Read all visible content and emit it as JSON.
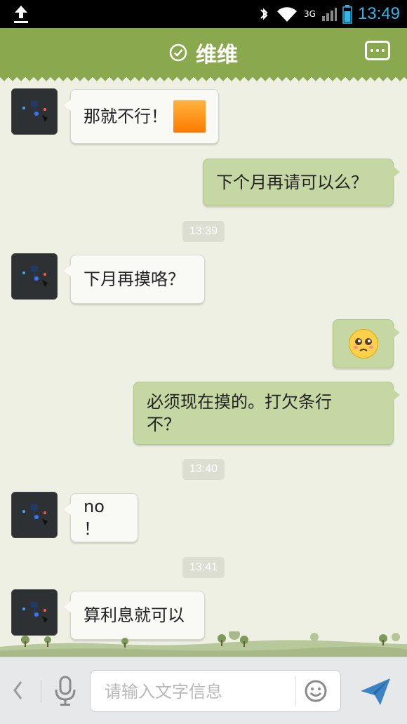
{
  "status_bar": {
    "time": "13:49",
    "network_label": "3G",
    "icons": [
      "upload-icon",
      "bluetooth-icon",
      "wifi-icon",
      "signal-icon",
      "battery-icon"
    ]
  },
  "header": {
    "title": "维维",
    "status_icon": "check-circle-icon",
    "menu_icon": "more-icon"
  },
  "messages": [
    {
      "side": "in",
      "text": "那就不行！",
      "sticker": "orange-sticker"
    },
    {
      "side": "out",
      "text": "下个月再请可以么？"
    },
    {
      "type": "timestamp",
      "text": "13:39"
    },
    {
      "side": "in",
      "text": "下月再摸咯？"
    },
    {
      "side": "out",
      "emoji": "crying-face-emoji"
    },
    {
      "side": "out",
      "text": "必须现在摸的。打欠条行不？"
    },
    {
      "type": "timestamp",
      "text": "13:40"
    },
    {
      "side": "in",
      "text": "no ！"
    },
    {
      "type": "timestamp",
      "text": "13:41"
    },
    {
      "side": "in",
      "text": "算利息就可以"
    }
  ],
  "input_bar": {
    "placeholder": "请输入文字信息",
    "value": "",
    "icons": [
      "back-chevron-icon",
      "microphone-icon",
      "smiley-icon",
      "send-icon"
    ]
  },
  "colors": {
    "header_green": "#8aa94e",
    "out_bubble": "#c5d7a2",
    "in_bubble": "#f9f9f6",
    "background": "#eef0e4",
    "time_accent": "#33b5e5"
  }
}
